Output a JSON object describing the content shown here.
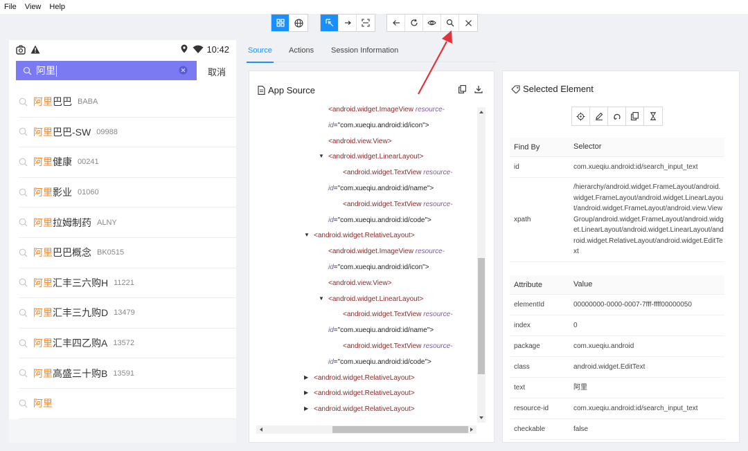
{
  "menubar": {
    "items": [
      "File",
      "View",
      "Help"
    ]
  },
  "device": {
    "time": "10:42",
    "search_value": "阿里",
    "cancel_label": "取消",
    "results": [
      {
        "hl": "阿里",
        "rest": "巴巴",
        "code": "BABA"
      },
      {
        "hl": "阿里",
        "rest": "巴巴-SW",
        "code": "09988"
      },
      {
        "hl": "阿里",
        "rest": "健康",
        "code": "00241"
      },
      {
        "hl": "阿里",
        "rest": "影业",
        "code": "01060"
      },
      {
        "hl": "阿里",
        "rest": "拉姆制药",
        "code": "ALNY"
      },
      {
        "hl": "阿里",
        "rest": "巴巴概念",
        "code": "BK0515"
      },
      {
        "hl": "阿里",
        "rest": "汇丰三六购H",
        "code": "11221"
      },
      {
        "hl": "阿里",
        "rest": "汇丰三九购D",
        "code": "13479"
      },
      {
        "hl": "阿里",
        "rest": "汇丰四乙购A",
        "code": "13572"
      },
      {
        "hl": "阿里",
        "rest": "高盛三十购B",
        "code": "13591"
      },
      {
        "hl": "阿里",
        "rest": "",
        "code": ""
      }
    ]
  },
  "tabs": {
    "source": "Source",
    "actions": "Actions",
    "session": "Session Information"
  },
  "source": {
    "title": "App Source",
    "tree": [
      {
        "indent": 3,
        "tag": "<android.widget.ImageView",
        "attr": "resource-",
        "val": ""
      },
      {
        "indent": 3,
        "tag": "",
        "attr": "id",
        "val": "=\"com.xueqiu.android:id/icon\">"
      },
      {
        "indent": 3,
        "tag": "<android.view.View>",
        "attr": "",
        "val": ""
      },
      {
        "indent": 3,
        "caret": "▼",
        "tag": "<android.widget.LinearLayout>",
        "attr": "",
        "val": ""
      },
      {
        "indent": 4,
        "tag": "<android.widget.TextView",
        "attr": "resource-",
        "val": ""
      },
      {
        "indent": 3,
        "tag": "",
        "attr": "id",
        "val": "=\"com.xueqiu.android:id/name\">"
      },
      {
        "indent": 4,
        "tag": "<android.widget.TextView",
        "attr": "resource-",
        "val": ""
      },
      {
        "indent": 3,
        "tag": "",
        "attr": "id",
        "val": "=\"com.xueqiu.android:id/code\">"
      },
      {
        "indent": 2,
        "caret": "▼",
        "tag": "<android.widget.RelativeLayout>",
        "attr": "",
        "val": ""
      },
      {
        "indent": 3,
        "tag": "<android.widget.ImageView",
        "attr": "resource-",
        "val": ""
      },
      {
        "indent": 3,
        "tag": "",
        "attr": "id",
        "val": "=\"com.xueqiu.android:id/icon\">"
      },
      {
        "indent": 3,
        "tag": "<android.view.View>",
        "attr": "",
        "val": ""
      },
      {
        "indent": 3,
        "caret": "▼",
        "tag": "<android.widget.LinearLayout>",
        "attr": "",
        "val": ""
      },
      {
        "indent": 4,
        "tag": "<android.widget.TextView",
        "attr": "resource-",
        "val": ""
      },
      {
        "indent": 3,
        "tag": "",
        "attr": "id",
        "val": "=\"com.xueqiu.android:id/name\">"
      },
      {
        "indent": 4,
        "tag": "<android.widget.TextView",
        "attr": "resource-",
        "val": ""
      },
      {
        "indent": 3,
        "tag": "",
        "attr": "id",
        "val": "=\"com.xueqiu.android:id/code\">"
      },
      {
        "indent": 2,
        "caret": "▶",
        "tag": "<android.widget.RelativeLayout>",
        "attr": "",
        "val": ""
      },
      {
        "indent": 2,
        "caret": "▶",
        "tag": "<android.widget.RelativeLayout>",
        "attr": "",
        "val": ""
      },
      {
        "indent": 2,
        "caret": "▶",
        "tag": "<android.widget.RelativeLayout>",
        "attr": "",
        "val": ""
      }
    ]
  },
  "selected": {
    "title": "Selected Element",
    "findby": {
      "headers": [
        "Find By",
        "Selector"
      ],
      "rows": [
        [
          "id",
          "com.xueqiu.android:id/search_input_text"
        ],
        [
          "xpath",
          "/hierarchy/android.widget.FrameLayout/android.widget.FrameLayout/android.widget.LinearLayout/android.widget.FrameLayout/android.view.ViewGroup/android.widget.FrameLayout/android.widget.LinearLayout/android.widget.LinearLayout/android.widget.RelativeLayout/android.widget.EditText"
        ]
      ]
    },
    "attributes": {
      "headers": [
        "Attribute",
        "Value"
      ],
      "rows": [
        [
          "elementId",
          "00000000-0000-0007-7fff-ffff00000050"
        ],
        [
          "index",
          "0"
        ],
        [
          "package",
          "com.xueqiu.android"
        ],
        [
          "class",
          "android.widget.EditText"
        ],
        [
          "text",
          "阿里"
        ],
        [
          "resource-id",
          "com.xueqiu.android:id/search_input_text"
        ],
        [
          "checkable",
          "false"
        ]
      ]
    }
  },
  "colors": {
    "accent": "#1890ff",
    "search_bg": "#7b7af2",
    "highlight": "#f08a2c",
    "arrow": "#e0323a"
  }
}
